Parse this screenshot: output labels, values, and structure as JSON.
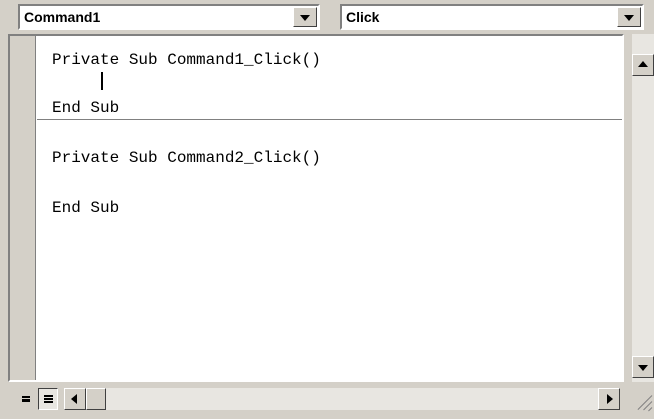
{
  "object_combo": {
    "value": "Command1"
  },
  "procedure_combo": {
    "value": "Click"
  },
  "code": {
    "procedures": [
      {
        "lines": [
          "Private Sub Command1_Click()",
          "",
          "End Sub"
        ]
      },
      {
        "lines": [
          "Private Sub Command2_Click()",
          "",
          "End Sub"
        ]
      }
    ]
  },
  "icons": {
    "dropdown": "chevron-down-icon",
    "scroll_up": "arrow-up-icon",
    "scroll_down": "arrow-down-icon",
    "scroll_left": "arrow-left-icon",
    "scroll_right": "arrow-right-icon",
    "procedure_view": "procedure-view-icon",
    "full_module_view": "full-module-view-icon",
    "resize_grip": "resize-grip-icon"
  },
  "colors": {
    "chrome": "#d4d0c8",
    "editor_background": "#ffffff",
    "text": "#000000"
  }
}
